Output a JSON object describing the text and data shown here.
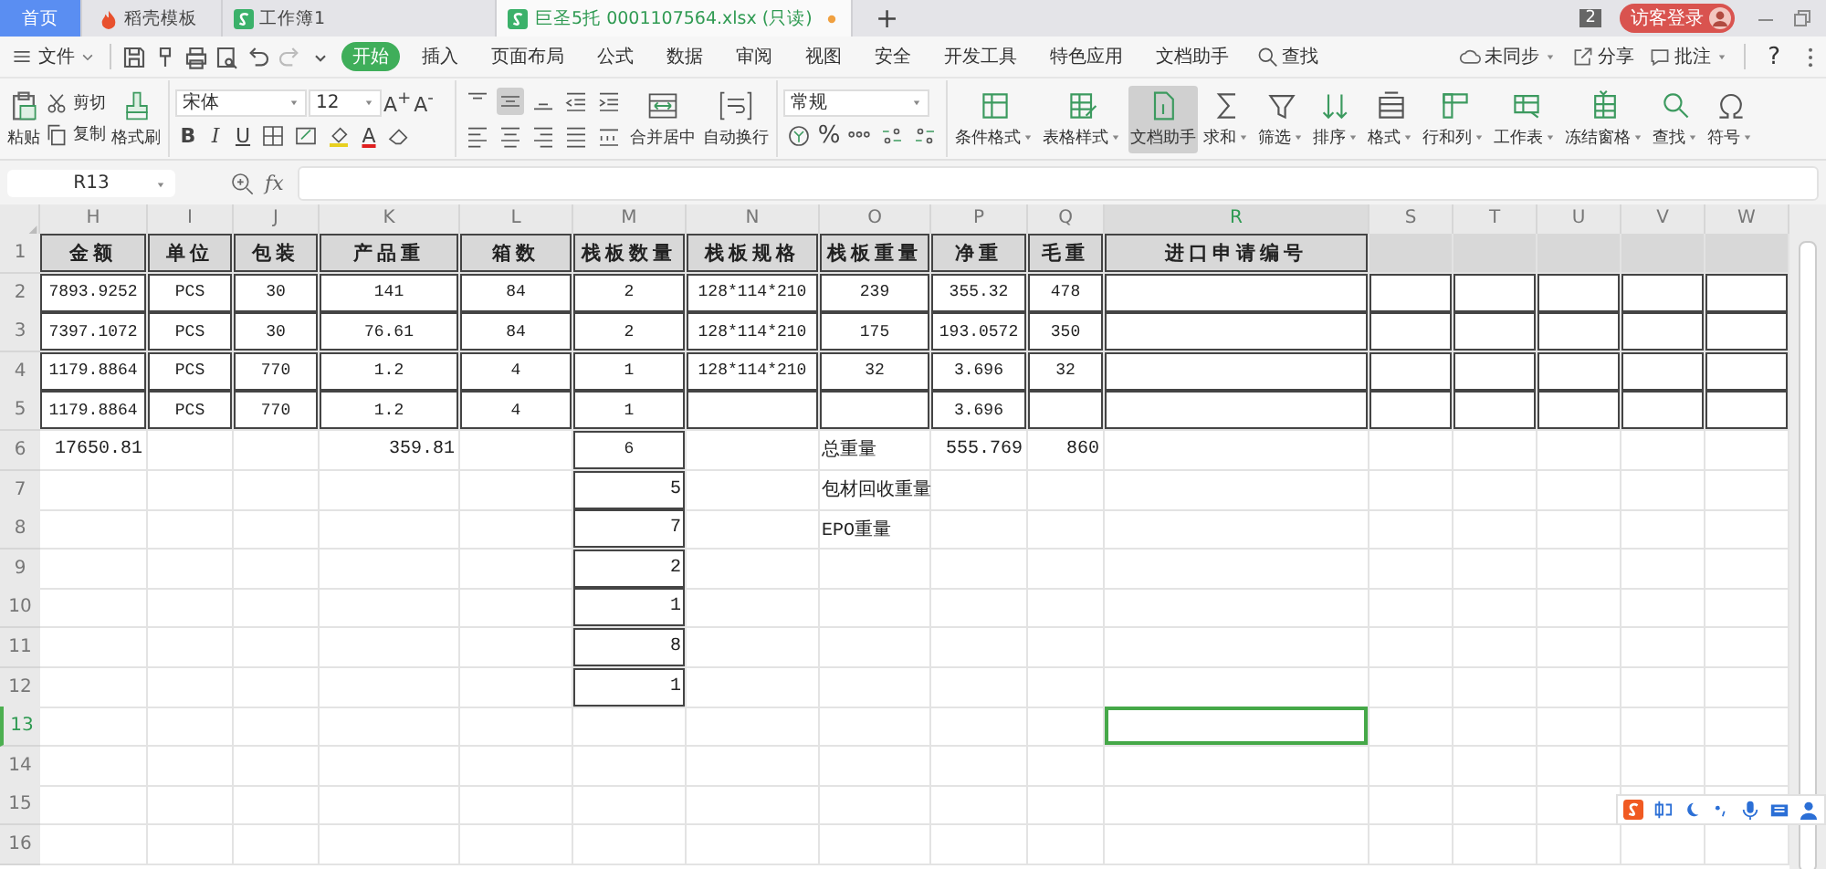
{
  "tabs": [
    {
      "label": "首页",
      "kind": "home",
      "selected": false
    },
    {
      "label": "稻壳模板",
      "kind": "docer",
      "selected": false
    },
    {
      "label": "工作簿1",
      "kind": "sheet",
      "selected": false
    },
    {
      "label": "巨圣5托 0001107564.xlsx (只读)",
      "kind": "sheet",
      "selected": true,
      "modified": true
    }
  ],
  "new_tab": "+",
  "window_count": "2",
  "login_button": "访客登录",
  "menu": {
    "file": "文件",
    "tabs": [
      {
        "label": "开始",
        "selected": true
      },
      {
        "label": "插入",
        "selected": false
      },
      {
        "label": "页面布局",
        "selected": false
      },
      {
        "label": "公式",
        "selected": false
      },
      {
        "label": "数据",
        "selected": false
      },
      {
        "label": "审阅",
        "selected": false
      },
      {
        "label": "视图",
        "selected": false
      },
      {
        "label": "安全",
        "selected": false
      },
      {
        "label": "开发工具",
        "selected": false
      },
      {
        "label": "特色应用",
        "selected": false
      },
      {
        "label": "文档助手",
        "selected": false
      }
    ],
    "search": "查找",
    "actions": [
      {
        "label": "未同步",
        "dropdown": true
      },
      {
        "label": "分享",
        "dropdown": false
      },
      {
        "label": "批注",
        "dropdown": true
      }
    ],
    "help": "?"
  },
  "ribbon": {
    "paste": "粘贴",
    "cut": "剪切",
    "copy": "复制",
    "format_painter": "格式刷",
    "font_name": "宋体",
    "font_size": "12",
    "grow_font": "A$^{+}$",
    "shrink_font": "A$^{-}$",
    "styles": [
      "B",
      "I",
      "U"
    ],
    "font_color": "A",
    "merge": "合并居中",
    "wrap": "自动换行",
    "number_format": "常规",
    "percent": "%",
    "big_buttons": [
      {
        "label": "条件格式",
        "dropdown": true,
        "pressed": false
      },
      {
        "label": "表格样式",
        "dropdown": true,
        "pressed": false
      },
      {
        "label": "文档助手",
        "dropdown": false,
        "pressed": true
      },
      {
        "label": "求和",
        "dropdown": true,
        "pressed": false
      },
      {
        "label": "筛选",
        "dropdown": true,
        "pressed": false
      },
      {
        "label": "排序",
        "dropdown": true,
        "pressed": false
      },
      {
        "label": "格式",
        "dropdown": true,
        "pressed": false
      },
      {
        "label": "行和列",
        "dropdown": true,
        "pressed": false
      },
      {
        "label": "工作表",
        "dropdown": true,
        "pressed": false
      },
      {
        "label": "冻结窗格",
        "dropdown": true,
        "pressed": false
      },
      {
        "label": "查找",
        "dropdown": true,
        "pressed": false
      },
      {
        "label": "符号",
        "dropdown": true,
        "pressed": false
      }
    ]
  },
  "formula_bar": {
    "cell_ref": "R13",
    "fx": "fx"
  },
  "sheet": {
    "columns": [
      {
        "label": "H",
        "selected": false
      },
      {
        "label": "I",
        "selected": false
      },
      {
        "label": "J",
        "selected": false
      },
      {
        "label": "K",
        "selected": false
      },
      {
        "label": "L",
        "selected": false
      },
      {
        "label": "M",
        "selected": false
      },
      {
        "label": "N",
        "selected": false
      },
      {
        "label": "O",
        "selected": false
      },
      {
        "label": "P",
        "selected": false
      },
      {
        "label": "Q",
        "selected": false
      },
      {
        "label": "R",
        "selected": true
      },
      {
        "label": "S",
        "selected": false
      },
      {
        "label": "T",
        "selected": false
      },
      {
        "label": "U",
        "selected": false
      },
      {
        "label": "V",
        "selected": false
      },
      {
        "label": "W",
        "selected": false
      }
    ],
    "rows": [
      {
        "number": "1",
        "kind": "header",
        "selected": false,
        "cells": [
          "金额",
          "单位",
          "包装",
          "产品重",
          "箱数",
          "栈板数量",
          "栈板规格",
          "栈板重量",
          "净重",
          "毛重",
          "进口申请编号",
          null,
          null,
          null,
          null,
          null
        ]
      },
      {
        "number": "2",
        "kind": "data",
        "selected": false,
        "cells": [
          "7893.9252",
          "PCS",
          "30",
          "141",
          "84",
          "2",
          "128*114*210",
          "239",
          "355.32",
          "478",
          null,
          null,
          null,
          null,
          null,
          null
        ]
      },
      {
        "number": "3",
        "kind": "data",
        "selected": false,
        "cells": [
          "7397.1072",
          "PCS",
          "30",
          "76.61",
          "84",
          "2",
          "128*114*210",
          "175",
          "193.0572",
          "350",
          null,
          null,
          null,
          null,
          null,
          null
        ]
      },
      {
        "number": "4",
        "kind": "data",
        "selected": false,
        "cells": [
          "1179.8864",
          "PCS",
          "770",
          "1.2",
          "4",
          "1",
          "128*114*210",
          "32",
          "3.696",
          "32",
          null,
          null,
          null,
          null,
          null,
          null
        ]
      },
      {
        "number": "5",
        "kind": "data",
        "selected": false,
        "cells": [
          "1179.8864",
          "PCS",
          "770",
          "1.2",
          "4",
          "1",
          null,
          null,
          "3.696",
          null,
          null,
          null,
          null,
          null,
          null,
          null
        ]
      },
      {
        "number": "6",
        "kind": "total",
        "selected": false,
        "cells": [
          "17650.81",
          null,
          null,
          "359.81",
          null,
          "6",
          null,
          "总重量",
          "555.769",
          "860",
          null,
          null,
          null,
          null,
          null,
          null
        ]
      },
      {
        "number": "7",
        "kind": "count",
        "selected": false,
        "cells": [
          null,
          null,
          null,
          null,
          null,
          "5",
          null,
          "包材回收重量",
          null,
          null,
          null,
          null,
          null,
          null,
          null,
          null
        ]
      },
      {
        "number": "8",
        "kind": "count",
        "selected": false,
        "cells": [
          null,
          null,
          null,
          null,
          null,
          "7",
          null,
          "EPO重量",
          null,
          null,
          null,
          null,
          null,
          null,
          null,
          null
        ]
      },
      {
        "number": "9",
        "kind": "count",
        "selected": false,
        "cells": [
          null,
          null,
          null,
          null,
          null,
          "2",
          null,
          null,
          null,
          null,
          null,
          null,
          null,
          null,
          null,
          null
        ]
      },
      {
        "number": "10",
        "kind": "count",
        "selected": false,
        "cells": [
          null,
          null,
          null,
          null,
          null,
          "1",
          null,
          null,
          null,
          null,
          null,
          null,
          null,
          null,
          null,
          null
        ]
      },
      {
        "number": "11",
        "kind": "count",
        "selected": false,
        "cells": [
          null,
          null,
          null,
          null,
          null,
          "8",
          null,
          null,
          null,
          null,
          null,
          null,
          null,
          null,
          null,
          null
        ]
      },
      {
        "number": "12",
        "kind": "count",
        "selected": false,
        "cells": [
          null,
          null,
          null,
          null,
          null,
          "1",
          null,
          null,
          null,
          null,
          null,
          null,
          null,
          null,
          null,
          null
        ]
      },
      {
        "number": "13",
        "kind": "blank",
        "selected": true,
        "cells": [
          null,
          null,
          null,
          null,
          null,
          null,
          null,
          null,
          null,
          null,
          null,
          null,
          null,
          null,
          null,
          null
        ]
      },
      {
        "number": "14",
        "kind": "blank",
        "selected": false,
        "cells": [
          null,
          null,
          null,
          null,
          null,
          null,
          null,
          null,
          null,
          null,
          null,
          null,
          null,
          null,
          null,
          null
        ]
      },
      {
        "number": "15",
        "kind": "blank",
        "selected": false,
        "cells": [
          null,
          null,
          null,
          null,
          null,
          null,
          null,
          null,
          null,
          null,
          null,
          null,
          null,
          null,
          null,
          null
        ]
      },
      {
        "number": "16",
        "kind": "blank",
        "selected": false,
        "cells": [
          null,
          null,
          null,
          null,
          null,
          null,
          null,
          null,
          null,
          null,
          null,
          null,
          null,
          null,
          null,
          null
        ]
      }
    ]
  }
}
